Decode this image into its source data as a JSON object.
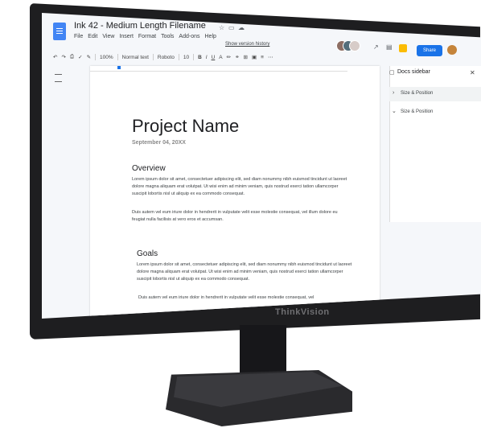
{
  "document": {
    "title": "Ink 42 - Medium Length Filename",
    "menu": [
      "File",
      "Edit",
      "View",
      "Insert",
      "Format",
      "Tools",
      "Add-ons",
      "Help"
    ],
    "version_history_link": "Show version history"
  },
  "toolbar": {
    "zoom": "100%",
    "style": "Normal text",
    "font": "Roboto",
    "font_size": "10",
    "format_buttons": [
      "B",
      "I",
      "U",
      "A"
    ]
  },
  "share_button": {
    "label": "Share"
  },
  "sidebar": {
    "title": "Docs sidebar",
    "items": [
      {
        "label": "Size & Position",
        "expanded": false
      },
      {
        "label": "Size & Position",
        "expanded": true
      }
    ]
  },
  "page": {
    "heading": "Project Name",
    "date": "September 04, 20XX",
    "sections": [
      {
        "title": "Overview",
        "paragraphs": [
          "Lorem ipsum dolor sit amet, consectetuer adipiscing elit, sed diam nonummy nibh euismod tincidunt ut laoreet dolore magna aliquam erat volutpat. Ut wisi enim ad minim veniam, quis nostrud exerci tation ullamcorper suscipit lobortis nisl ut aliquip ex ea commodo consequat.",
          "Duis autem vel eum iriure dolor in hendrerit in vulputate velit esse molestie consequat, vel illum dolore eu feugiat nulla facilisis at vero eros et accumsan."
        ]
      },
      {
        "title": "Goals",
        "paragraphs": [
          "Lorem ipsum dolor sit amet, consectetuer adipiscing elit, sed diam nonummy nibh euismod tincidunt ut laoreet dolore magna aliquam erat volutpat. Ut wisi enim ad minim veniam, quis nostrud exerci tation ullamcorper suscipit lobortis nisl ut aliquip ex ea commodo consequat.",
          "Duis autem vel eum iriure dolor in hendrerit in vulputate velit esse molestie consequat, vel"
        ]
      }
    ]
  },
  "monitor": {
    "brand": "ThinkVision"
  },
  "colors": {
    "accent": "#1a73e8",
    "docs_blue": "#4285f4",
    "bezel": "#1e1e20"
  }
}
